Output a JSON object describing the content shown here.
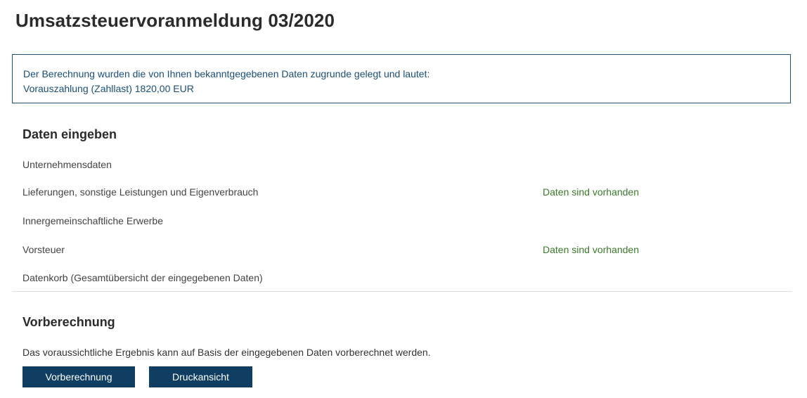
{
  "page": {
    "title": "Umsatzsteuervoranmeldung 03/2020"
  },
  "info": {
    "line1": "Der Berechnung wurden die von Ihnen bekanntgegebenen Daten zugrunde gelegt und lautet:",
    "line2": "Vorauszahlung (Zahllast) 1820,00 EUR"
  },
  "daten_eingeben": {
    "title": "Daten eingeben",
    "items": [
      {
        "label": "Unternehmensdaten",
        "status": ""
      },
      {
        "label": "Lieferungen, sonstige Leistungen und Eigenverbrauch",
        "status": "Daten sind vorhanden"
      },
      {
        "label": "Innergemeinschaftliche Erwerbe",
        "status": ""
      },
      {
        "label": "Vorsteuer",
        "status": "Daten sind vorhanden"
      },
      {
        "label": "Datenkorb (Gesamtübersicht der eingegebenen Daten)",
        "status": ""
      }
    ]
  },
  "vorberechnung": {
    "title": "Vorberechnung",
    "description": "Das voraussichtliche Ergebnis kann auf Basis der eingegebenen Daten vorberechnet werden.",
    "button_vorberechnung": "Vorberechnung",
    "button_druckansicht": "Druckansicht"
  },
  "colors": {
    "info_text": "#1a4f7a",
    "info_border": "#1f4e79",
    "status_green": "#3a7a2a",
    "button_bg": "#0f3e62"
  }
}
